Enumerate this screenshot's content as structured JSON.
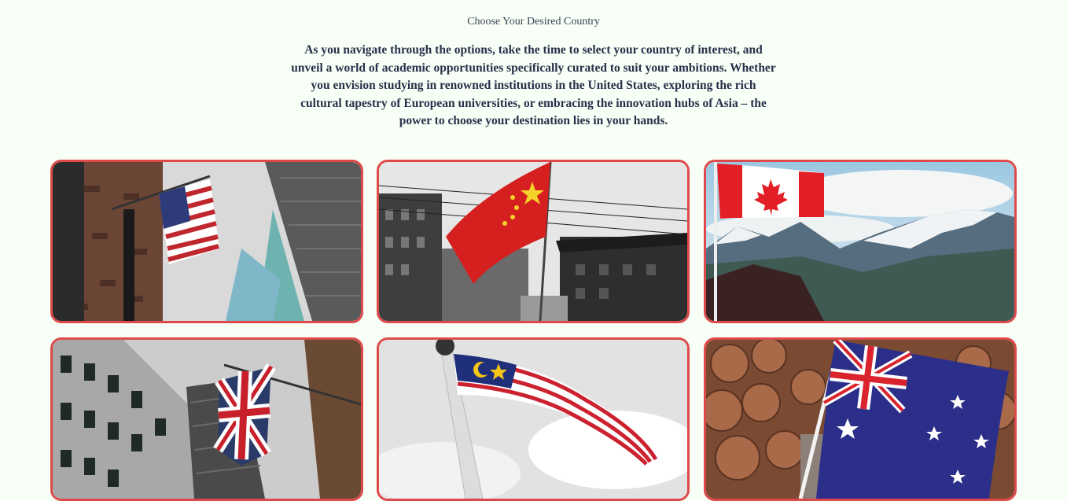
{
  "section": {
    "eyebrow": "Choose Your Desired Country",
    "intro": "As you navigate through the options, take the time to select your country of interest, and unveil a world of academic opportunities specifically curated to suit your ambitions. Whether you envision studying in renowned institutions in the United States, exploring the rich cultural tapestry of European universities, or embracing the innovation hubs of Asia – the power to choose your destination lies in your hands."
  },
  "colors": {
    "background": "#f8fff6",
    "card_border": "#de4a4a",
    "text": "#27304a"
  },
  "countries": [
    {
      "image": "usa-flag-building-photo"
    },
    {
      "image": "china-flag-street-photo"
    },
    {
      "image": "canada-flag-mountains-photo"
    },
    {
      "image": "uk-flag-building-photo"
    },
    {
      "image": "malaysia-flag-sky-photo"
    },
    {
      "image": "australia-flag-logs-photo"
    }
  ]
}
